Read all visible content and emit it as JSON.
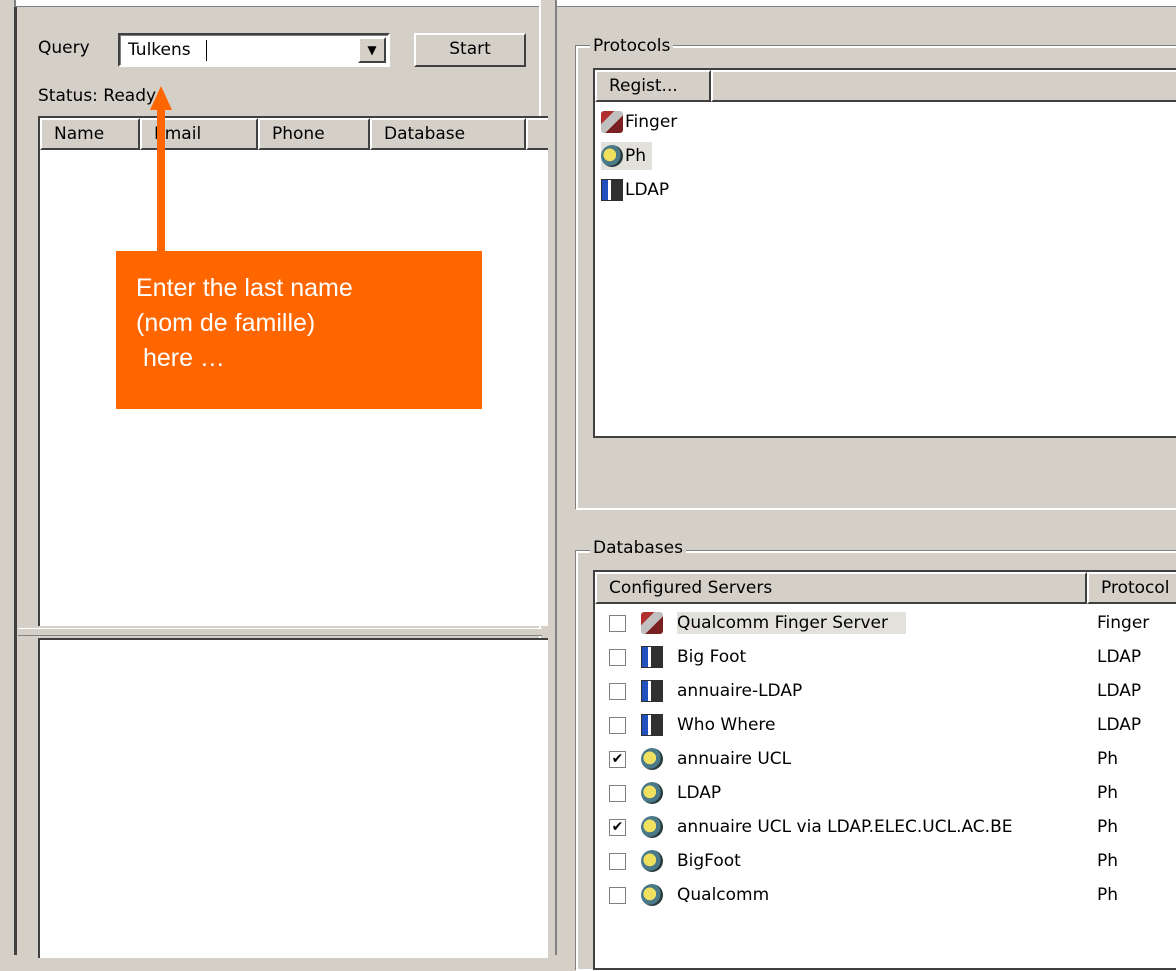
{
  "query": {
    "label": "Query",
    "value": "Tulkens",
    "start_label": "Start"
  },
  "status": "Status: Ready",
  "results": {
    "columns": [
      "Name",
      "Email",
      "Phone",
      "Database"
    ]
  },
  "callout": {
    "lines": [
      "Enter the last name",
      "(nom de famille)",
      " here …"
    ],
    "color": "#ff6600"
  },
  "protocols": {
    "legend": "Protocols",
    "column": "Regist...",
    "items": [
      {
        "label": "Finger",
        "icon": "finger-icon"
      },
      {
        "label": "Ph",
        "icon": "ph-icon"
      },
      {
        "label": "LDAP",
        "icon": "ldap-icon"
      }
    ]
  },
  "databases": {
    "legend": "Databases",
    "columns": [
      "Configured Servers",
      "Protocol"
    ],
    "rows": [
      {
        "name": "Qualcomm Finger Server",
        "protocol": "Finger",
        "checked": false,
        "icon": "finger-icon"
      },
      {
        "name": "Big Foot",
        "protocol": "LDAP",
        "checked": false,
        "icon": "ldap-icon"
      },
      {
        "name": "annuaire-LDAP",
        "protocol": "LDAP",
        "checked": false,
        "icon": "ldap-icon"
      },
      {
        "name": "Who Where",
        "protocol": "LDAP",
        "checked": false,
        "icon": "ldap-icon"
      },
      {
        "name": "annuaire UCL",
        "protocol": "Ph",
        "checked": true,
        "icon": "ph-icon"
      },
      {
        "name": "LDAP",
        "protocol": "Ph",
        "checked": false,
        "icon": "ph-icon"
      },
      {
        "name": "annuaire UCL via LDAP.ELEC.UCL.AC.BE",
        "protocol": "Ph",
        "checked": true,
        "icon": "ph-icon"
      },
      {
        "name": "BigFoot",
        "protocol": "Ph",
        "checked": false,
        "icon": "ph-icon"
      },
      {
        "name": "Qualcomm",
        "protocol": "Ph",
        "checked": false,
        "icon": "ph-icon"
      }
    ]
  }
}
